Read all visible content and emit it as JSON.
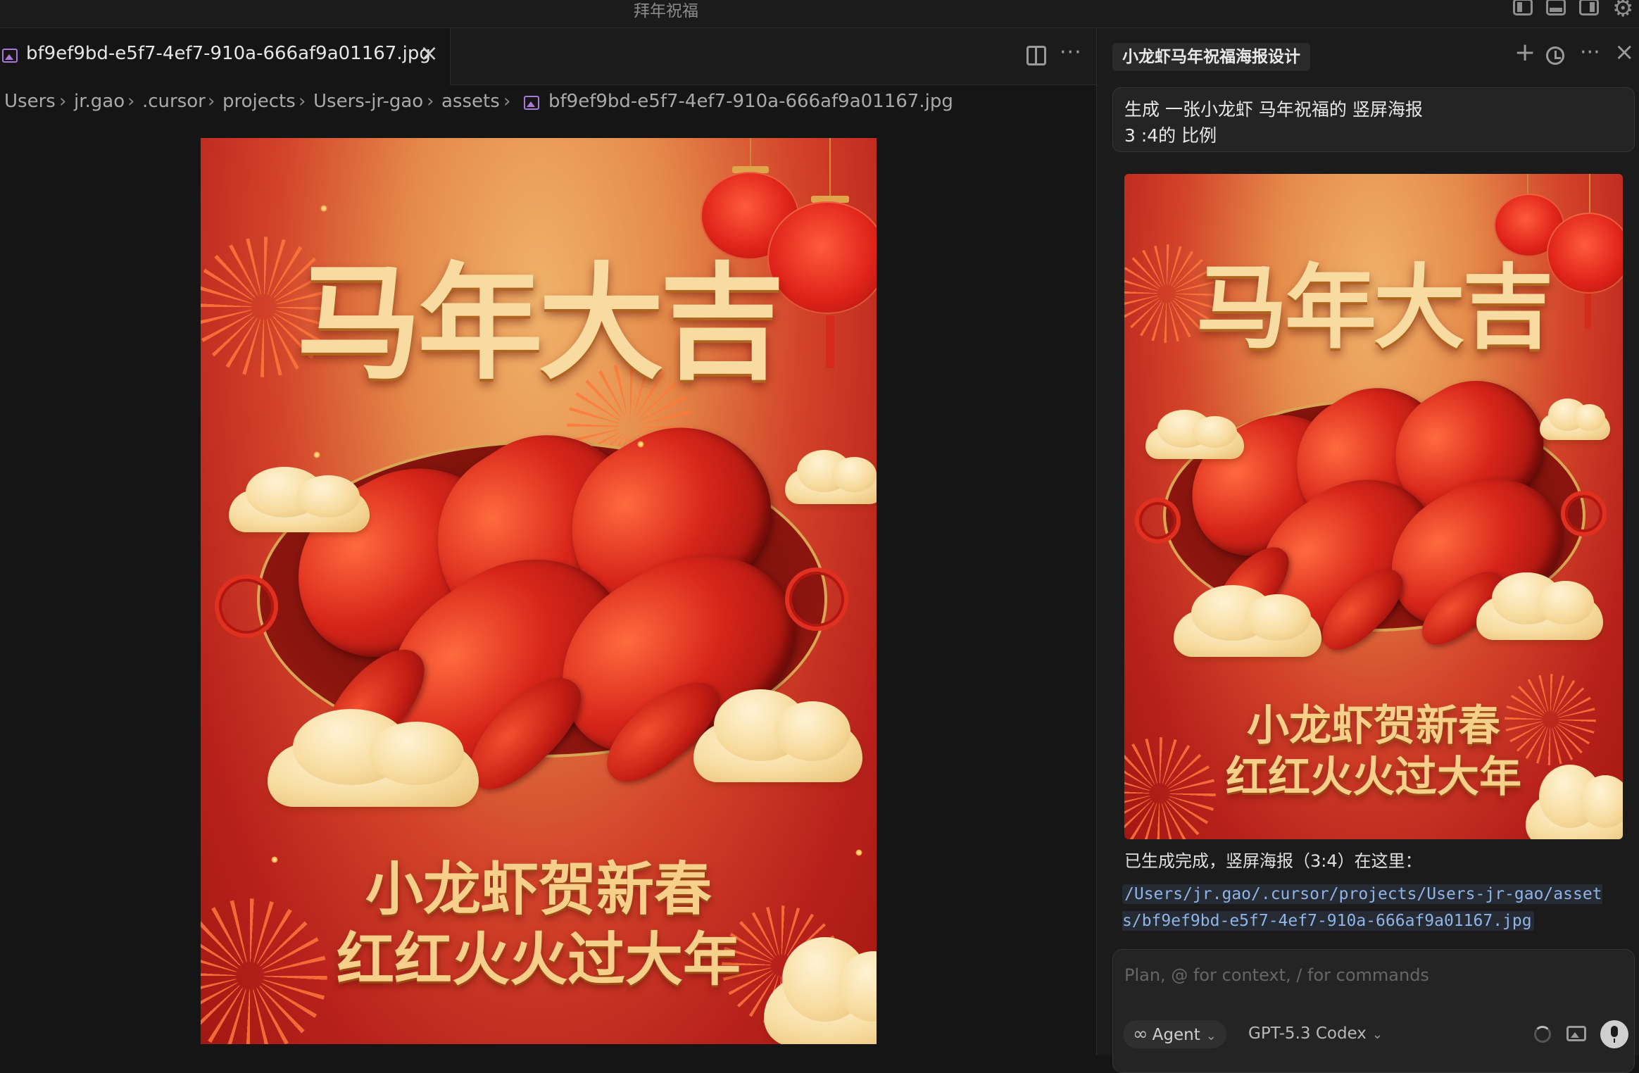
{
  "window": {
    "title": "拜年祝福"
  },
  "editor": {
    "tab": {
      "label": "bf9ef9bd-e5f7-4ef7-910a-666af9a01167.jpg",
      "close_glyph": "×"
    },
    "more_glyph": "···",
    "breadcrumb": [
      "Users",
      "jr.gao",
      ".cursor",
      "projects",
      "Users-jr-gao",
      "assets",
      "bf9ef9bd-e5f7-4ef7-910a-666af9a01167.jpg"
    ],
    "breadcrumb_sep": "›"
  },
  "poster": {
    "title": "马年大吉",
    "line1": "小龙虾贺新春",
    "line2": "红红火火过大年"
  },
  "chat": {
    "title": "小龙虾马年祝福海报设计",
    "new_glyph": "+",
    "more_glyph": "···",
    "close_glyph": "×",
    "user_message": {
      "line1": "生成 一张小龙虾 马年祝福的 竖屏海报",
      "line2": "3 :4的 比例"
    },
    "assistant_text": "已生成完成，竖屏海报（3:4）在这里：",
    "result_path": "/Users/jr.gao/.cursor/projects/Users-jr-gao/assets/bf9ef9bd-e5f7-4ef7-910a-666af9a01167.jpg",
    "input": {
      "placeholder": "Plan, @ for context, / for commands",
      "mode": "Agent",
      "model": "GPT-5.3 Codex",
      "chevron": "⌄"
    }
  },
  "icons": {
    "image-file-icon": "image file",
    "infinity-icon": "∞",
    "settings-icon": "⚙"
  },
  "colors": {
    "background": "#151515",
    "panel": "#1b1b1b",
    "link": "#8fb4e8",
    "poster_red": "#b8211b",
    "poster_gold": "#f8dba0"
  }
}
